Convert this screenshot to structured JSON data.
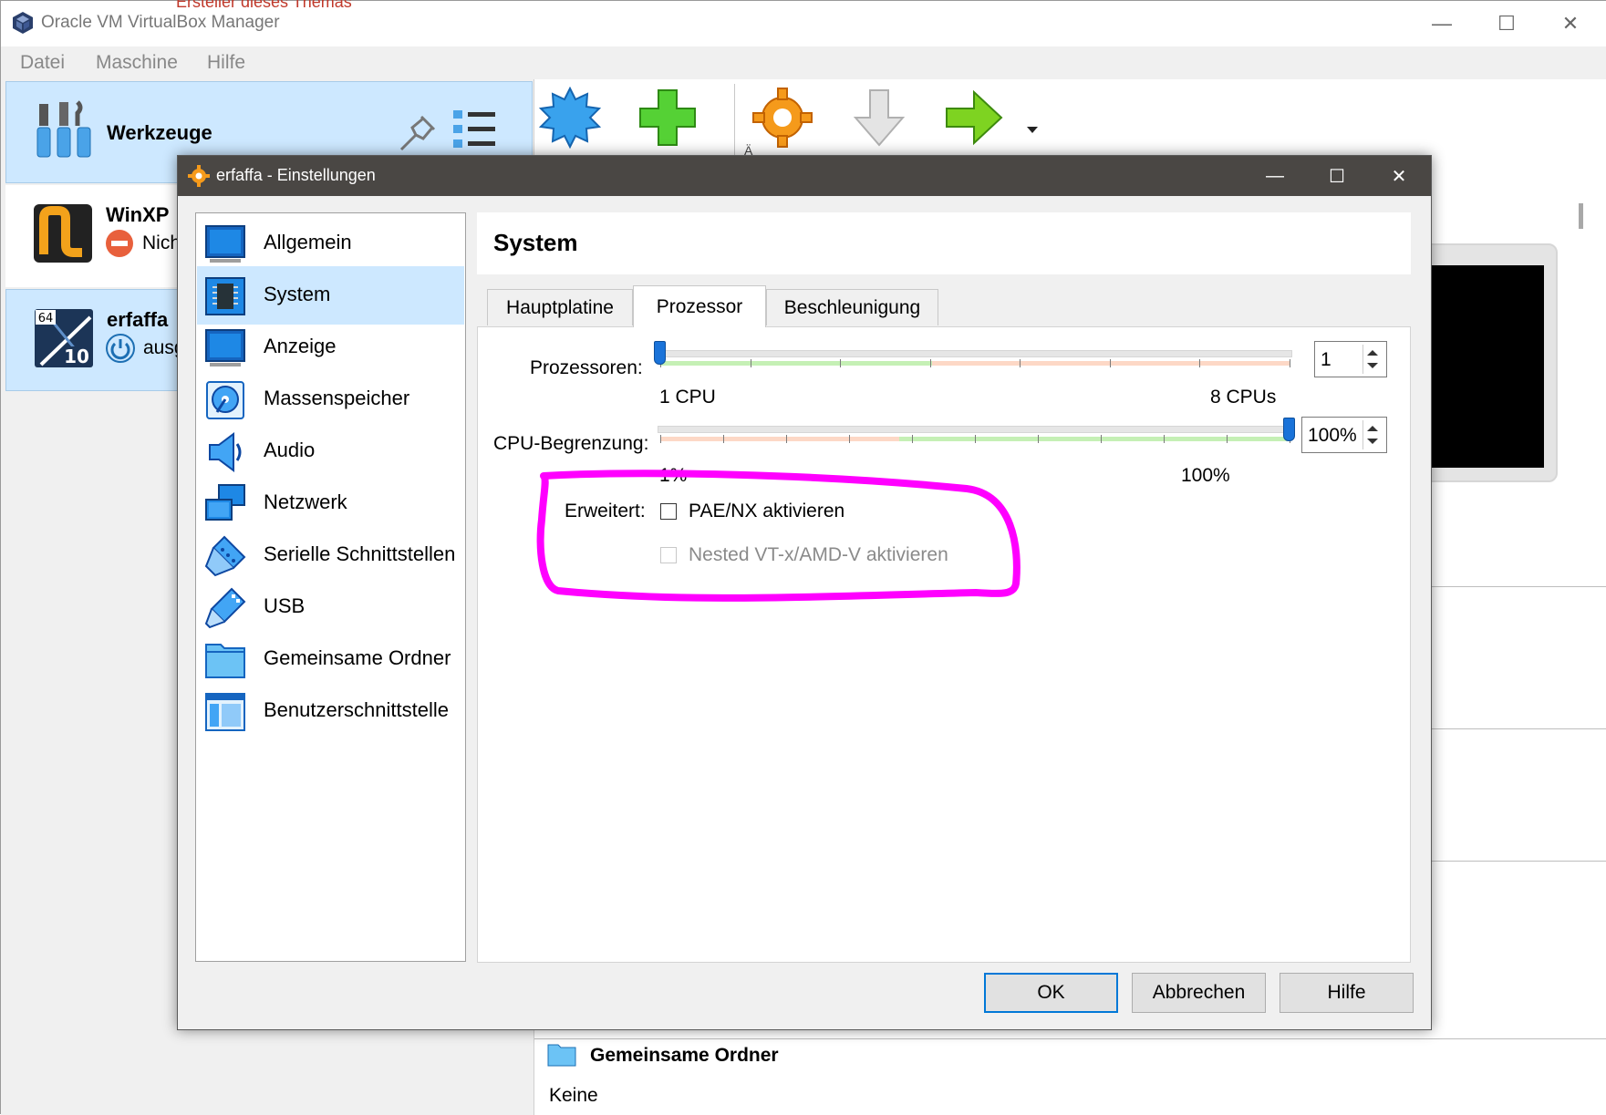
{
  "main_window": {
    "title": "Oracle VM VirtualBox Manager",
    "menu": [
      "Datei",
      "Maschine",
      "Hilfe"
    ],
    "tools_label": "Werkzeuge",
    "vms": [
      {
        "name": "WinXP",
        "state": "Nich",
        "os_badge": ""
      },
      {
        "name": "erfaffa",
        "state": "ausg",
        "os_badge": "10",
        "arch_badge": "64"
      }
    ],
    "toolbar_overflow_text": "Ä",
    "details": {
      "shared_folders_title": "Gemeinsame Ordner",
      "shared_folders_value": "Keine"
    },
    "top_partial_text": "Ersteller dieses Themas"
  },
  "dialog": {
    "title": "erfaffa - Einstellungen",
    "sidebar": [
      {
        "label": "Allgemein",
        "icon": "general-icon"
      },
      {
        "label": "System",
        "icon": "system-chip-icon",
        "selected": true
      },
      {
        "label": "Anzeige",
        "icon": "display-icon"
      },
      {
        "label": "Massenspeicher",
        "icon": "storage-icon"
      },
      {
        "label": "Audio",
        "icon": "audio-icon"
      },
      {
        "label": "Netzwerk",
        "icon": "network-icon"
      },
      {
        "label": "Serielle Schnittstellen",
        "icon": "serial-port-icon"
      },
      {
        "label": "USB",
        "icon": "usb-icon"
      },
      {
        "label": "Gemeinsame Ordner",
        "icon": "shared-folder-icon"
      },
      {
        "label": "Benutzerschnittstelle",
        "icon": "user-interface-icon"
      }
    ],
    "page_title": "System",
    "tabs": [
      "Hauptplatine",
      "Prozessor",
      "Beschleunigung"
    ],
    "active_tab": "Prozessor",
    "processors": {
      "label": "Prozessoren:",
      "value": "1",
      "min_label": "1 CPU",
      "max_label": "8 CPUs",
      "min": 1,
      "max": 8,
      "current": 1
    },
    "cpu_cap": {
      "label": "CPU-Begrenzung:",
      "value": "100%",
      "min_label": "1%",
      "max_label": "100%",
      "current_percent": 100
    },
    "extended": {
      "label": "Erweitert:",
      "pae_label": "PAE/NX aktivieren",
      "pae_checked": false,
      "nested_label": "Nested VT-x/AMD-V aktivieren",
      "nested_checked": false,
      "nested_enabled": false
    },
    "buttons": {
      "ok": "OK",
      "cancel": "Abbrechen",
      "help": "Hilfe"
    }
  },
  "colors": {
    "selection": "#cde8ff",
    "dialog_titlebar": "#4a4744",
    "highlight_annotation": "#ff00ff",
    "accent": "#0078d7"
  }
}
